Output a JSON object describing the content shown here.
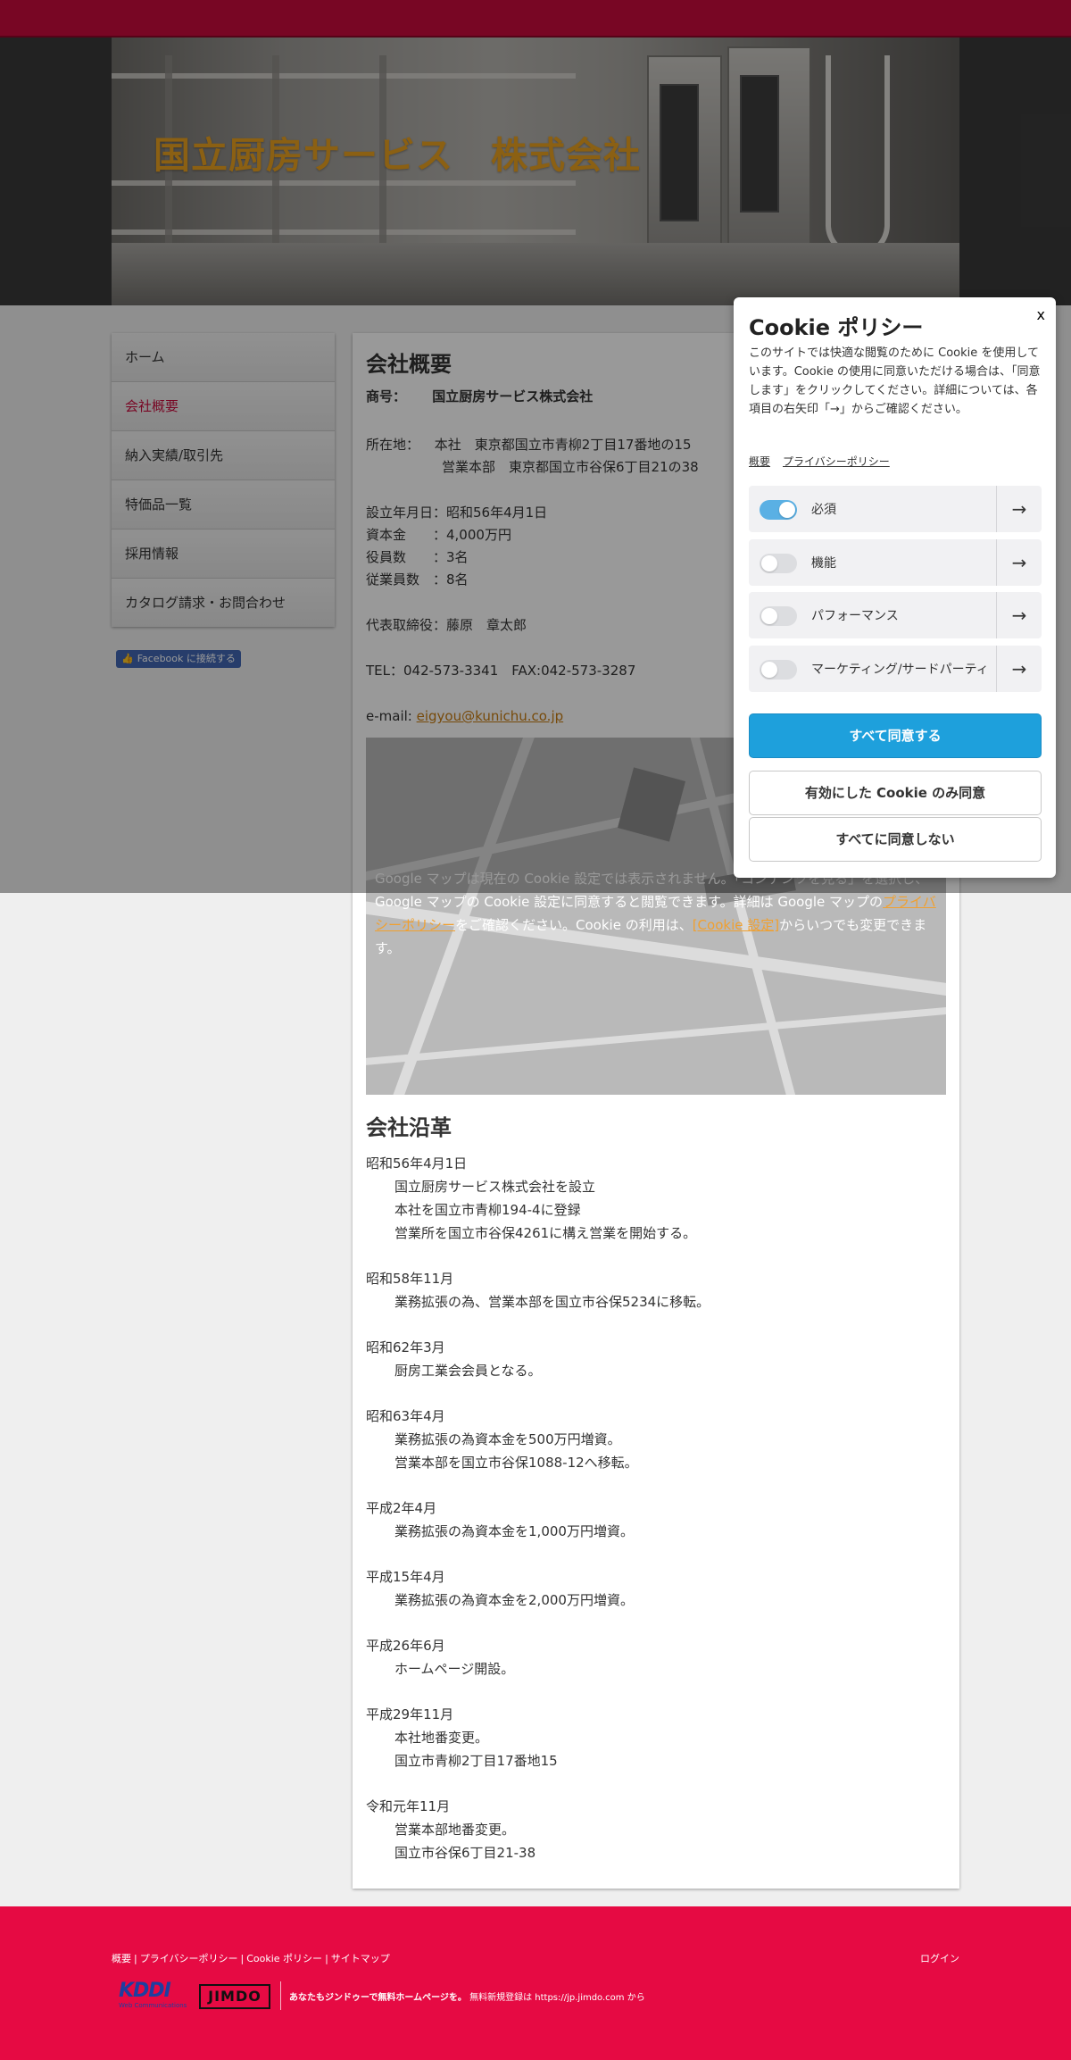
{
  "site": {
    "title": "国立厨房サービス　株式会社"
  },
  "nav": {
    "items": [
      {
        "label": "ホーム",
        "active": false
      },
      {
        "label": "会社概要",
        "active": true
      },
      {
        "label": "納入実績/取引先",
        "active": false
      },
      {
        "label": "特価品一覧",
        "active": false
      },
      {
        "label": "採用情報",
        "active": false
      },
      {
        "label": "カタログ請求・お問合わせ",
        "active": false
      }
    ],
    "facebook_button": "Facebook に接続する"
  },
  "overview": {
    "heading": "会社概要",
    "trade_name_label": "商号：",
    "trade_name": "国立厨房サービス株式会社",
    "address_label": "所在地：",
    "address_line1": "本社　東京都国立市青柳2丁目17番地の15",
    "address_line2": "営業本部　東京都国立市谷保6丁目21の38",
    "established": "設立年月日：昭和56年4月1日",
    "capital": "資本金　　：4,000万円",
    "officers": "役員数　　：3名",
    "employees": "従業員数　：8名",
    "representative": "代表取締役：藤原　章太郎",
    "tel_fax": "TEL：042-573-3341　FAX:042-573-3287",
    "email_label": "e-mail: ",
    "email": "eigyou@kunichu.co.jp"
  },
  "map_notice": {
    "text_before": "Google マップは現在の Cookie 設定では表示されません。「コンテンツを見る」を選択し、Google マップの Cookie 設定に同意すると閲覧できます。詳細は Google マップの",
    "privacy_link": "プライバシーポリシー",
    "text_middle": "をご確認ください。Cookie の利用は、",
    "cookie_settings_link": "[Cookie 設定]",
    "text_after": "からいつでも変更できます。"
  },
  "history": {
    "heading": "会社沿革",
    "entries": [
      {
        "date": "昭和56年4月1日",
        "lines": [
          "国立厨房サービス株式会社を設立",
          "本社を国立市青柳194-4に登録",
          "営業所を国立市谷保4261に構え営業を開始する。"
        ]
      },
      {
        "date": "昭和58年11月",
        "lines": [
          "業務拡張の為、営業本部を国立市谷保5234に移転。"
        ]
      },
      {
        "date": "昭和62年3月",
        "lines": [
          "厨房工業会会員となる。"
        ]
      },
      {
        "date": "昭和63年4月",
        "lines": [
          "業務拡張の為資本金を500万円増資。",
          "営業本部を国立市谷保1088-12へ移転。"
        ]
      },
      {
        "date": "平成2年4月",
        "lines": [
          "業務拡張の為資本金を1,000万円増資。"
        ]
      },
      {
        "date": "平成15年4月",
        "lines": [
          "業務拡張の為資本金を2,000万円増資。"
        ]
      },
      {
        "date": "平成26年6月",
        "lines": [
          "ホームページ開設。"
        ]
      },
      {
        "date": "平成29年11月",
        "lines": [
          "本社地番変更。",
          "国立市青柳2丁目17番地15"
        ]
      },
      {
        "date": "令和元年11月",
        "lines": [
          "営業本部地番変更。",
          "国立市谷保6丁目21-38"
        ]
      }
    ]
  },
  "footer": {
    "links": [
      "概要",
      "プライバシーポリシー",
      "Cookie ポリシー",
      "サイトマップ"
    ],
    "login": "ログイン",
    "kddi_logo": "KDDI",
    "kddi_sub": "Web Communications",
    "jimdo_logo": "JIMDO",
    "promo_bold": "あなたもジンドゥーで無料ホームページを。",
    "promo_text": " 無料新規登録は https://jp.jimdo.com から"
  },
  "cookie": {
    "close": "x",
    "title": "Cookie ポリシー",
    "description": "このサイトでは快適な閲覧のために Cookie を使用しています。Cookie の使用に同意いただける場合は、「同意します」をクリックしてください。詳細については、各項目の右矢印「→」からご確認ください。",
    "link_overview": "概要",
    "link_privacy": "プライバシーポリシー",
    "categories": [
      {
        "label": "必須",
        "enabled": true
      },
      {
        "label": "機能",
        "enabled": false
      },
      {
        "label": "パフォーマンス",
        "enabled": false
      },
      {
        "label": "マーケティング/サードパーティ",
        "enabled": false
      }
    ],
    "arrow_icon": "→",
    "accept_all": "すべて同意する",
    "accept_selected": "有効にした Cookie のみ同意",
    "decline_all": "すべてに同意しない"
  },
  "colors": {
    "brand_red": "#e60a43",
    "title_orange": "#e8a020",
    "accept_blue": "#1ea0dc",
    "toggle_on": "#5ab0e4"
  }
}
